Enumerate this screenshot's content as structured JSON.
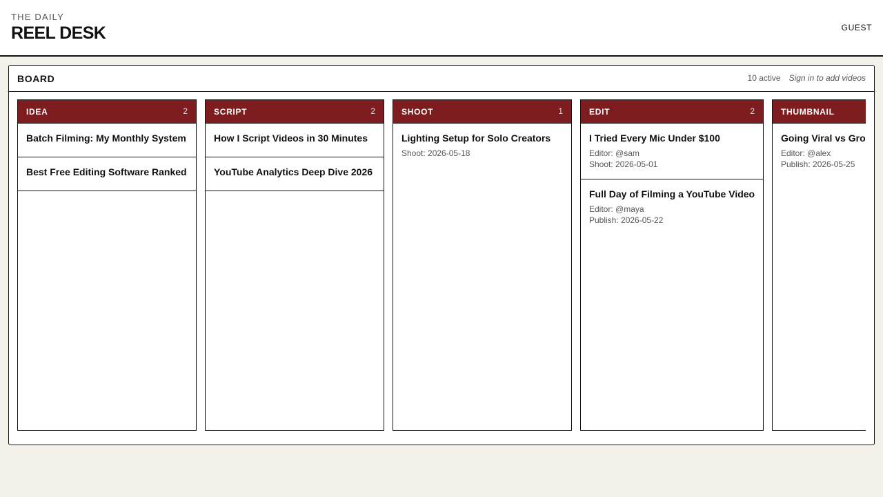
{
  "header": {
    "kicker": "THE DAILY",
    "title": "REEL DESK",
    "user": "GUEST"
  },
  "board": {
    "title": "BOARD",
    "active": "10 active",
    "signin": "Sign in to add videos"
  },
  "colors": {
    "accent": "#7d1d20",
    "background": "#f4f1ea"
  },
  "columns": [
    {
      "name": "IDEA",
      "count": "2",
      "cards": [
        {
          "title": "Batch Filming: My Monthly System"
        },
        {
          "title": "Best Free Editing Software Ranked"
        }
      ]
    },
    {
      "name": "SCRIPT",
      "count": "2",
      "cards": [
        {
          "title": "How I Script Videos in 30 Minutes"
        },
        {
          "title": "YouTube Analytics Deep Dive 2026"
        }
      ]
    },
    {
      "name": "SHOOT",
      "count": "1",
      "cards": [
        {
          "title": "Lighting Setup for Solo Creators",
          "meta1": "Shoot: 2026-05-18"
        }
      ]
    },
    {
      "name": "EDIT",
      "count": "2",
      "cards": [
        {
          "title": "I Tried Every Mic Under $100",
          "meta1": "Editor: @sam",
          "meta2": "Shoot: 2026-05-01"
        },
        {
          "title": "Full Day of Filming a YouTube Video",
          "meta1": "Editor: @maya",
          "meta2": "Publish: 2026-05-22"
        }
      ]
    },
    {
      "name": "THUMBNAIL",
      "count": "",
      "cards": [
        {
          "title": "Going Viral vs Gro",
          "meta1": "Editor: @alex",
          "meta2": "Publish: 2026-05-25"
        }
      ]
    }
  ]
}
